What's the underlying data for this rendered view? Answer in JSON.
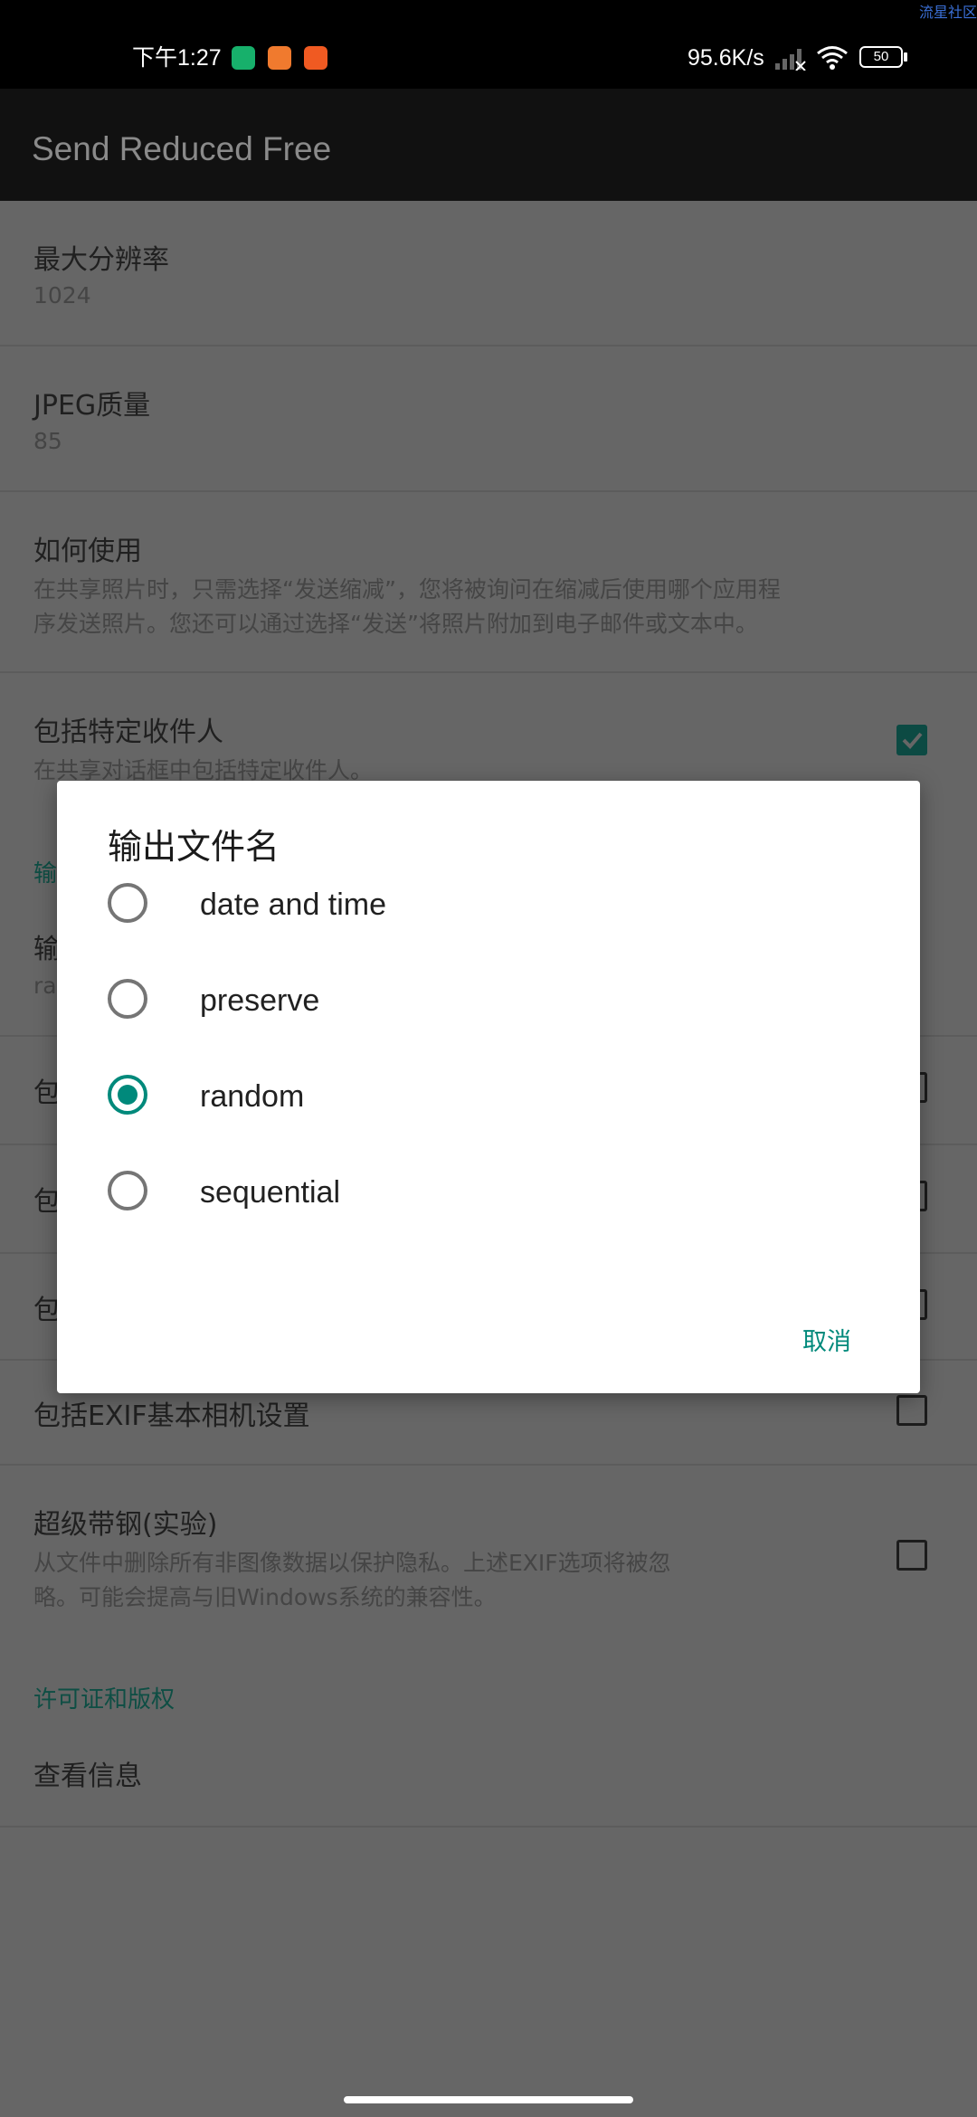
{
  "status_bar": {
    "time": "下午1:27",
    "net_speed": "95.6K/s",
    "battery": "50",
    "corner_tag": "流星社区"
  },
  "app_bar": {
    "title": "Send Reduced Free"
  },
  "settings": {
    "max_res": {
      "title": "最大分辨率",
      "value": "1024"
    },
    "jpeg": {
      "title": "JPEG质量",
      "value": "85"
    },
    "howto": {
      "title": "如何使用",
      "line1": "在共享照片时，只需选择“发送缩减”，您将被询问在缩减后使用哪个应用程",
      "line2": "序发送照片。您还可以通过选择“发送”将照片附加到电子邮件或文本中。"
    },
    "recipients": {
      "title": "包括特定收件人",
      "summary": "在共享对话框中包括特定收件人。",
      "checked": true
    },
    "behind_dialog": {
      "section_head": "输",
      "row_title": "输",
      "row_value": "ra",
      "row3": "包",
      "row4": "包",
      "row5": "包"
    },
    "exif_basic": {
      "title": "包括EXIF基本相机设置",
      "checked": false
    },
    "super_strip": {
      "title": "超级带钢(实验)",
      "line1": "从文件中删除所有非图像数据以保护隐私。上述EXIF选项将被忽",
      "line2": "略。可能会提高与旧Windows系统的兼容性。",
      "checked": false
    },
    "license_section": "许可证和版权",
    "view_info": "查看信息"
  },
  "dialog": {
    "title": "输出文件名",
    "options": [
      "date and time",
      "preserve",
      "random",
      "sequential"
    ],
    "selected": "random",
    "cancel": "取消"
  },
  "colors": {
    "accent": "#00897b",
    "scrim_bg": "#666666"
  }
}
